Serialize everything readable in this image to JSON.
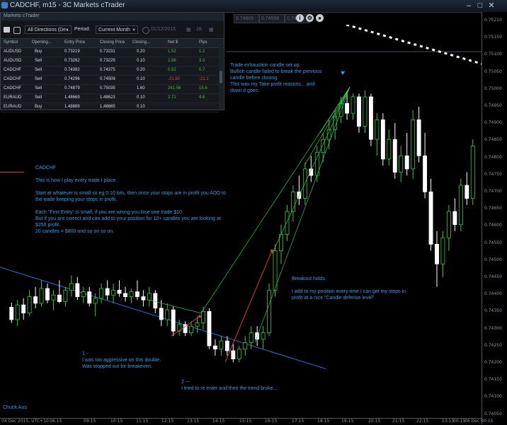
{
  "window": {
    "title": "CADCHF, m15 - 3C Markets cTrader"
  },
  "toolbar": {
    "fields": [
      "0.74605",
      "0.74598",
      "0.74612"
    ]
  },
  "panel": {
    "title": "Markets cTrader",
    "direction": "All Directions (De...",
    "period_label": "Period:",
    "period_value": "Current Month",
    "date_value": "01/12/2015",
    "date_extra": "28",
    "headers": [
      "Symbol",
      "Opening...",
      "Entry Price",
      "Closing Price",
      "Closing...",
      "Net $",
      "Pips"
    ],
    "rows": [
      [
        "AUDUSD",
        "Buy",
        "0.73219",
        "0.73231",
        "0.20",
        "1.52",
        "1.2"
      ],
      [
        "AUDUSD",
        "Sell",
        "0.73262",
        "0.73229",
        "0.10",
        "2.86",
        "3.3"
      ],
      [
        "CADCHF",
        "Sell",
        "0.74382",
        "0.74375",
        "0.20",
        "0.52",
        "0.7"
      ],
      [
        "CADCHF",
        "Sell",
        "0.74296",
        "0.74509",
        "0.10",
        "-21.82",
        "-21.1"
      ],
      [
        "CADCHF",
        "Sell",
        "0.74879",
        "0.75035",
        "1.60",
        "241.56",
        "15.6"
      ],
      [
        "EURAUD",
        "Sell",
        "1.48669",
        "1.48623",
        "0.10",
        "2.71",
        "4.6"
      ]
    ],
    "partial_row": [
      "EURAUD",
      "Buy",
      "1.48889",
      "1.48665",
      "0.10",
      "",
      ""
    ]
  },
  "annotations": {
    "top": "Trade exhaustion candle set up.\nBullish candle failed to break the previous\ncandle before closing.\nThis was my Take profit reasons... and\ndown it goes.",
    "strategy": "CADCHF\n\nThis is how I play every trade I place.\n\nStart at whatever is small so eg 0.10 lots, then once your stops are in profit you ADD to\nthe trade keeping your stops in profit.\n\nEach \"First Entry\" is small, if you are wrong you lose one trade $10.\nBut if you are correct and can add to your position for 10+ candles you are looking at\n$250 profit.\n20 candles = $800 and so on so on.",
    "breakout": "Breakout holds.\n\nI add to my position every time I can get my stops in\nprofit at a nice \"Candle defense level\"",
    "one": "1 -\nI was too aggressive on this double.\nWas stopped out for breakeven.",
    "two": "2 ---\nI tried to re enter and then the trend broke...",
    "author": "Chuck.Aus"
  },
  "price_axis": [
    "0.75210",
    "0.75150",
    "0.75100",
    "0.75050",
    "0.75000",
    "0.74950",
    "0.74900",
    "0.74850",
    "0.74800",
    "0.74750",
    "0.74700",
    "0.74650",
    "0.74600",
    "0.74550",
    "0.74500",
    "0.74450",
    "0.74400",
    "0.74350",
    "0.74300",
    "0.74250",
    "0.74200",
    "0.74150",
    "0.74100",
    "0.74050"
  ],
  "time_axis": [
    "04 Dec 2015, UTC+10",
    "06:15",
    "09:15",
    "10:15",
    "11:15",
    "12:15",
    "13:15",
    "14:15",
    "15:15",
    "16:15",
    "17:15",
    "18:15",
    "19:15",
    "20:15",
    "21:15",
    "22:15",
    "23:15",
    "00:15",
    "06 Dec 00:15"
  ],
  "chart_data": {
    "type": "candlestick",
    "symbol": "CADCHF",
    "timeframe": "m15",
    "ylim": [
      0.7405,
      0.7525
    ],
    "colors": {
      "bull": "#2ecc40",
      "bear": "#ffffff",
      "trendline": "#2a6fd6",
      "arrow": "#e03a2a",
      "text": "#2f9fe8"
    },
    "candles": [
      {
        "o": 0.74388,
        "h": 0.74402,
        "l": 0.7434,
        "c": 0.7435
      },
      {
        "o": 0.7435,
        "h": 0.7441,
        "l": 0.7433,
        "c": 0.74395
      },
      {
        "o": 0.74395,
        "h": 0.74415,
        "l": 0.7435,
        "c": 0.7437
      },
      {
        "o": 0.7437,
        "h": 0.7444,
        "l": 0.7436,
        "c": 0.7442
      },
      {
        "o": 0.7442,
        "h": 0.7445,
        "l": 0.74385,
        "c": 0.744
      },
      {
        "o": 0.744,
        "h": 0.7447,
        "l": 0.7439,
        "c": 0.74445
      },
      {
        "o": 0.74445,
        "h": 0.7446,
        "l": 0.744,
        "c": 0.7441
      },
      {
        "o": 0.7441,
        "h": 0.7444,
        "l": 0.7438,
        "c": 0.74425
      },
      {
        "o": 0.74425,
        "h": 0.7447,
        "l": 0.744,
        "c": 0.74405
      },
      {
        "o": 0.74405,
        "h": 0.7445,
        "l": 0.7439,
        "c": 0.7444
      },
      {
        "o": 0.7444,
        "h": 0.74485,
        "l": 0.7442,
        "c": 0.7446
      },
      {
        "o": 0.7446,
        "h": 0.7448,
        "l": 0.7441,
        "c": 0.7442
      },
      {
        "o": 0.7442,
        "h": 0.7445,
        "l": 0.744,
        "c": 0.74435
      },
      {
        "o": 0.74435,
        "h": 0.7445,
        "l": 0.7439,
        "c": 0.744
      },
      {
        "o": 0.744,
        "h": 0.7443,
        "l": 0.7436,
        "c": 0.74415
      },
      {
        "o": 0.74415,
        "h": 0.7446,
        "l": 0.744,
        "c": 0.74445
      },
      {
        "o": 0.74445,
        "h": 0.7447,
        "l": 0.7441,
        "c": 0.74425
      },
      {
        "o": 0.74425,
        "h": 0.7446,
        "l": 0.744,
        "c": 0.7444
      },
      {
        "o": 0.7444,
        "h": 0.7447,
        "l": 0.7442,
        "c": 0.7443
      },
      {
        "o": 0.7443,
        "h": 0.7445,
        "l": 0.74405,
        "c": 0.7442
      },
      {
        "o": 0.7442,
        "h": 0.74445,
        "l": 0.744,
        "c": 0.74435
      },
      {
        "o": 0.74435,
        "h": 0.7447,
        "l": 0.7441,
        "c": 0.7442
      },
      {
        "o": 0.7442,
        "h": 0.7444,
        "l": 0.7439,
        "c": 0.7441
      },
      {
        "o": 0.7441,
        "h": 0.7445,
        "l": 0.7439,
        "c": 0.7443
      },
      {
        "o": 0.7443,
        "h": 0.7444,
        "l": 0.7437,
        "c": 0.74385
      },
      {
        "o": 0.74385,
        "h": 0.7441,
        "l": 0.7433,
        "c": 0.7435
      },
      {
        "o": 0.7435,
        "h": 0.744,
        "l": 0.7433,
        "c": 0.7438
      },
      {
        "o": 0.7438,
        "h": 0.7439,
        "l": 0.743,
        "c": 0.74315
      },
      {
        "o": 0.74315,
        "h": 0.7435,
        "l": 0.743,
        "c": 0.74335
      },
      {
        "o": 0.74335,
        "h": 0.74345,
        "l": 0.743,
        "c": 0.7431
      },
      {
        "o": 0.7431,
        "h": 0.74345,
        "l": 0.743,
        "c": 0.7433
      },
      {
        "o": 0.7433,
        "h": 0.7436,
        "l": 0.7431,
        "c": 0.7434
      },
      {
        "o": 0.7434,
        "h": 0.7439,
        "l": 0.7432,
        "c": 0.74375
      },
      {
        "o": 0.74375,
        "h": 0.74385,
        "l": 0.7426,
        "c": 0.7427
      },
      {
        "o": 0.7427,
        "h": 0.7429,
        "l": 0.7424,
        "c": 0.7426
      },
      {
        "o": 0.7426,
        "h": 0.743,
        "l": 0.7424,
        "c": 0.74285
      },
      {
        "o": 0.74285,
        "h": 0.743,
        "l": 0.7424,
        "c": 0.74255
      },
      {
        "o": 0.74255,
        "h": 0.74275,
        "l": 0.7422,
        "c": 0.7423
      },
      {
        "o": 0.7423,
        "h": 0.7427,
        "l": 0.7422,
        "c": 0.7426
      },
      {
        "o": 0.7426,
        "h": 0.743,
        "l": 0.7424,
        "c": 0.7428
      },
      {
        "o": 0.7428,
        "h": 0.7433,
        "l": 0.7426,
        "c": 0.7431
      },
      {
        "o": 0.7431,
        "h": 0.7433,
        "l": 0.7427,
        "c": 0.7429
      },
      {
        "o": 0.7429,
        "h": 0.7433,
        "l": 0.7426,
        "c": 0.7431
      },
      {
        "o": 0.7431,
        "h": 0.7446,
        "l": 0.743,
        "c": 0.7444
      },
      {
        "o": 0.7444,
        "h": 0.7458,
        "l": 0.7442,
        "c": 0.7456
      },
      {
        "o": 0.7456,
        "h": 0.7464,
        "l": 0.7452,
        "c": 0.7461
      },
      {
        "o": 0.7461,
        "h": 0.747,
        "l": 0.7459,
        "c": 0.7468
      },
      {
        "o": 0.7468,
        "h": 0.7476,
        "l": 0.7465,
        "c": 0.7474
      },
      {
        "o": 0.7474,
        "h": 0.7479,
        "l": 0.747,
        "c": 0.7472
      },
      {
        "o": 0.7472,
        "h": 0.7483,
        "l": 0.747,
        "c": 0.7481
      },
      {
        "o": 0.7481,
        "h": 0.7485,
        "l": 0.7477,
        "c": 0.7479
      },
      {
        "o": 0.7479,
        "h": 0.7488,
        "l": 0.7477,
        "c": 0.7486
      },
      {
        "o": 0.7486,
        "h": 0.7492,
        "l": 0.7483,
        "c": 0.749
      },
      {
        "o": 0.749,
        "h": 0.7496,
        "l": 0.7487,
        "c": 0.7493
      },
      {
        "o": 0.7493,
        "h": 0.7499,
        "l": 0.749,
        "c": 0.7497
      },
      {
        "o": 0.7497,
        "h": 0.7503,
        "l": 0.7495,
        "c": 0.7501
      },
      {
        "o": 0.7501,
        "h": 0.75045,
        "l": 0.7496,
        "c": 0.7498
      },
      {
        "o": 0.7498,
        "h": 0.7504,
        "l": 0.7496,
        "c": 0.7503
      },
      {
        "o": 0.7503,
        "h": 0.7504,
        "l": 0.7492,
        "c": 0.7494
      },
      {
        "o": 0.7494,
        "h": 0.7505,
        "l": 0.7492,
        "c": 0.7503
      },
      {
        "o": 0.7503,
        "h": 0.7504,
        "l": 0.7488,
        "c": 0.749
      },
      {
        "o": 0.749,
        "h": 0.7498,
        "l": 0.7485,
        "c": 0.7496
      },
      {
        "o": 0.7496,
        "h": 0.7498,
        "l": 0.7482,
        "c": 0.7484
      },
      {
        "o": 0.7484,
        "h": 0.7493,
        "l": 0.7482,
        "c": 0.749
      },
      {
        "o": 0.749,
        "h": 0.7495,
        "l": 0.7478,
        "c": 0.748
      },
      {
        "o": 0.748,
        "h": 0.7488,
        "l": 0.7477,
        "c": 0.7485
      },
      {
        "o": 0.7485,
        "h": 0.7492,
        "l": 0.7479,
        "c": 0.7481
      },
      {
        "o": 0.7481,
        "h": 0.7499,
        "l": 0.7478,
        "c": 0.7496
      },
      {
        "o": 0.7496,
        "h": 0.75,
        "l": 0.7483,
        "c": 0.7485
      },
      {
        "o": 0.7485,
        "h": 0.7492,
        "l": 0.7472,
        "c": 0.7474
      },
      {
        "o": 0.7474,
        "h": 0.7478,
        "l": 0.7456,
        "c": 0.7458
      },
      {
        "o": 0.7458,
        "h": 0.7462,
        "l": 0.7445,
        "c": 0.7452
      },
      {
        "o": 0.7452,
        "h": 0.7462,
        "l": 0.7448,
        "c": 0.746
      },
      {
        "o": 0.746,
        "h": 0.747,
        "l": 0.7456,
        "c": 0.7468
      },
      {
        "o": 0.7468,
        "h": 0.7472,
        "l": 0.7462,
        "c": 0.7464
      },
      {
        "o": 0.7464,
        "h": 0.7478,
        "l": 0.7462,
        "c": 0.7476
      },
      {
        "o": 0.7476,
        "h": 0.748,
        "l": 0.747,
        "c": 0.7472
      },
      {
        "o": 0.7472,
        "h": 0.749,
        "l": 0.747,
        "c": 0.7488
      }
    ]
  }
}
